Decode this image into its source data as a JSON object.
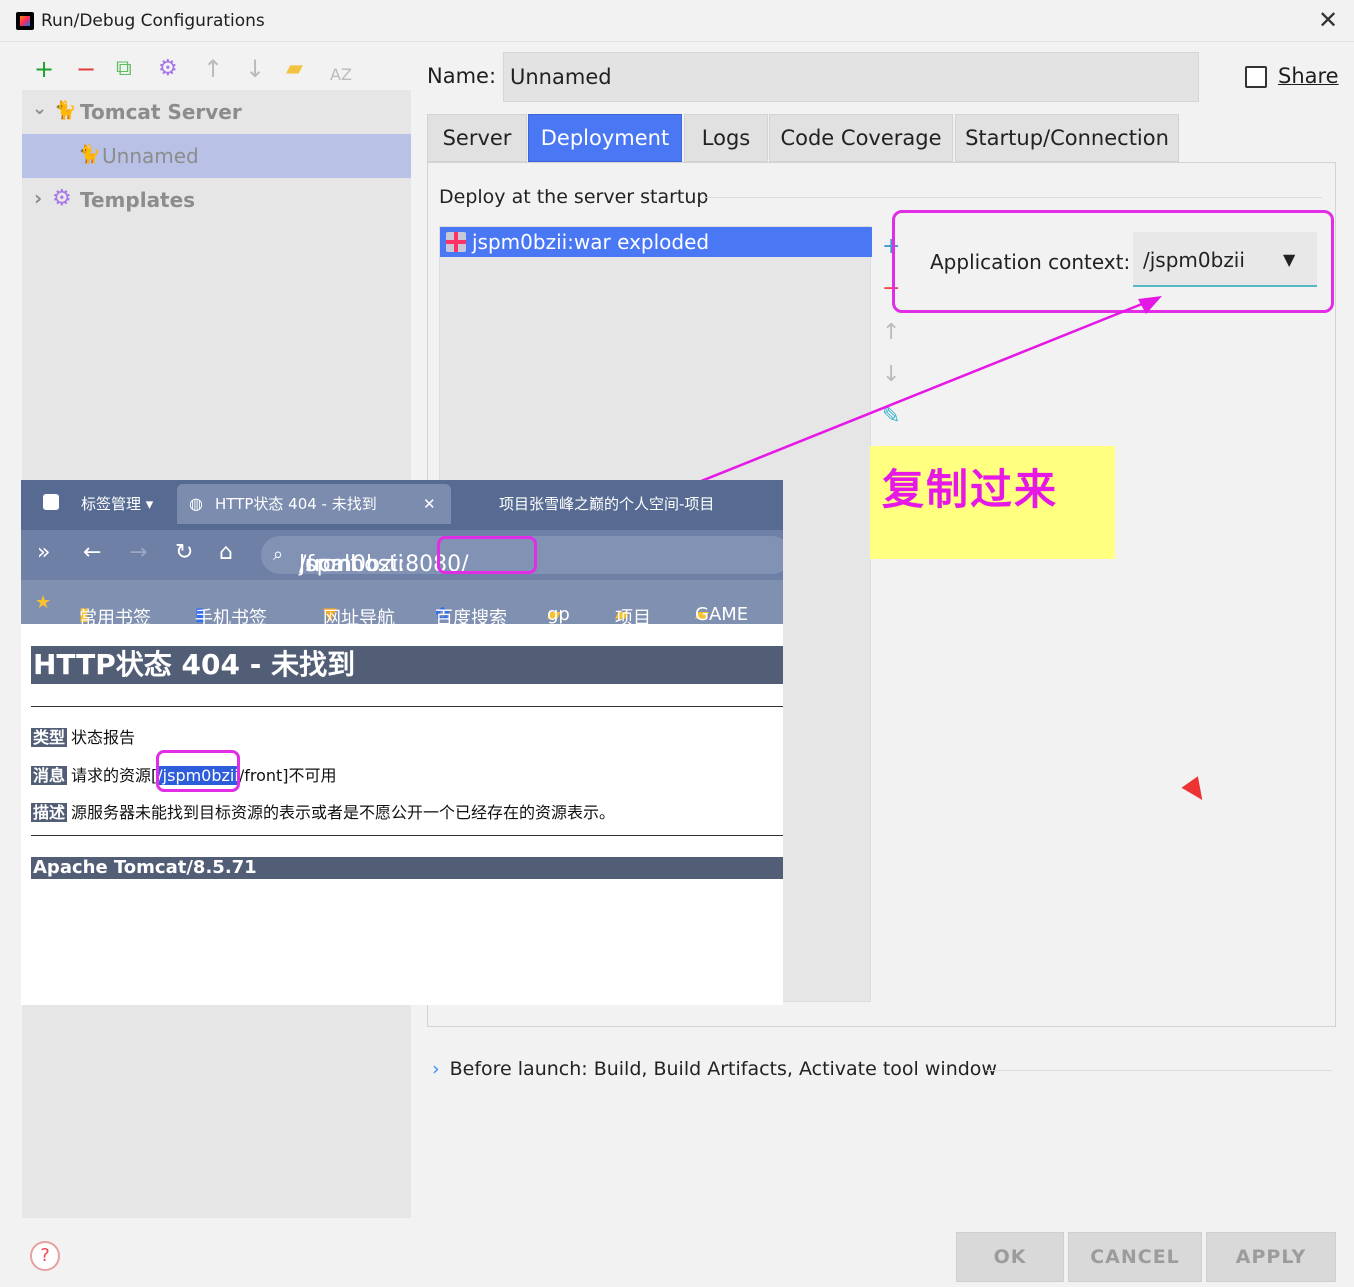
{
  "window": {
    "title": "Run/Debug Configurations",
    "close_glyph": "✕"
  },
  "toolbar": {
    "add": "+",
    "remove": "−",
    "copy": "⧉",
    "settings": "⚙",
    "up": "↑",
    "down": "↓",
    "folder": "▰",
    "sort": "AZ"
  },
  "tree": {
    "tomcat_server": "Tomcat Server",
    "unnamed": "Unnamed",
    "templates": "Templates",
    "expand_open": "⌄",
    "expand_closed": "›"
  },
  "form": {
    "name_label": "Name:",
    "name_value": "Unnamed",
    "share_label": "Share"
  },
  "tabs": [
    {
      "label": "Server"
    },
    {
      "label": "Deployment"
    },
    {
      "label": "Logs"
    },
    {
      "label": "Code Coverage"
    },
    {
      "label": "Startup/Connection"
    }
  ],
  "deployment": {
    "section_title": "Deploy at the server startup",
    "artifact": "jspm0bzii:war exploded",
    "add": "+",
    "remove": "−",
    "up": "↑",
    "down": "↓",
    "edit": "✎",
    "app_context_label": "Application context:",
    "app_context_value": "/jspm0bzii",
    "combo_arrow": "▼"
  },
  "annotation": {
    "text": "复制过来",
    "color": "#e618e6",
    "bg": "#ffff80"
  },
  "before_launch": {
    "chevron": "›",
    "text": "Before launch: Build, Build Artifacts, Activate tool window"
  },
  "buttons": {
    "help": "?",
    "ok": "OK",
    "cancel": "CANCEL",
    "apply": "APPLY"
  },
  "browser": {
    "tabs": [
      {
        "label": "标签管理 ▾"
      },
      {
        "label": "HTTP状态 404 - 未找到"
      },
      {
        "label": "项目张雪峰之巅的个人空间-项目"
      }
    ],
    "tab_close": "✕",
    "nav": {
      "more": "»",
      "back": "←",
      "forward": "→",
      "reload": "↻",
      "home": "⌂"
    },
    "url": {
      "prefix": "localhost:8080/",
      "highlight": "jspm0bzii",
      "suffix": "/front"
    },
    "bookmarks": [
      {
        "label": "常用书签"
      },
      {
        "label": "手机书签"
      },
      {
        "label": "网址导航"
      },
      {
        "label": "百度搜索"
      },
      {
        "label": "gp"
      },
      {
        "label": "项目"
      },
      {
        "label": "GAME"
      }
    ],
    "page": {
      "heading": "HTTP状态 404 - 未找到",
      "type_tag": "类型",
      "type_text": "状态报告",
      "msg_tag": "消息",
      "msg_before": "请求的资源[",
      "msg_slash": "/",
      "msg_highlight": "jspm0bzii",
      "msg_after": "/front]不可用",
      "desc_tag": "描述",
      "desc_text": "源服务器未能找到目标资源的表示或者是不愿公开一个已经存在的资源表示。",
      "footer": "Apache Tomcat/8.5.71"
    }
  }
}
